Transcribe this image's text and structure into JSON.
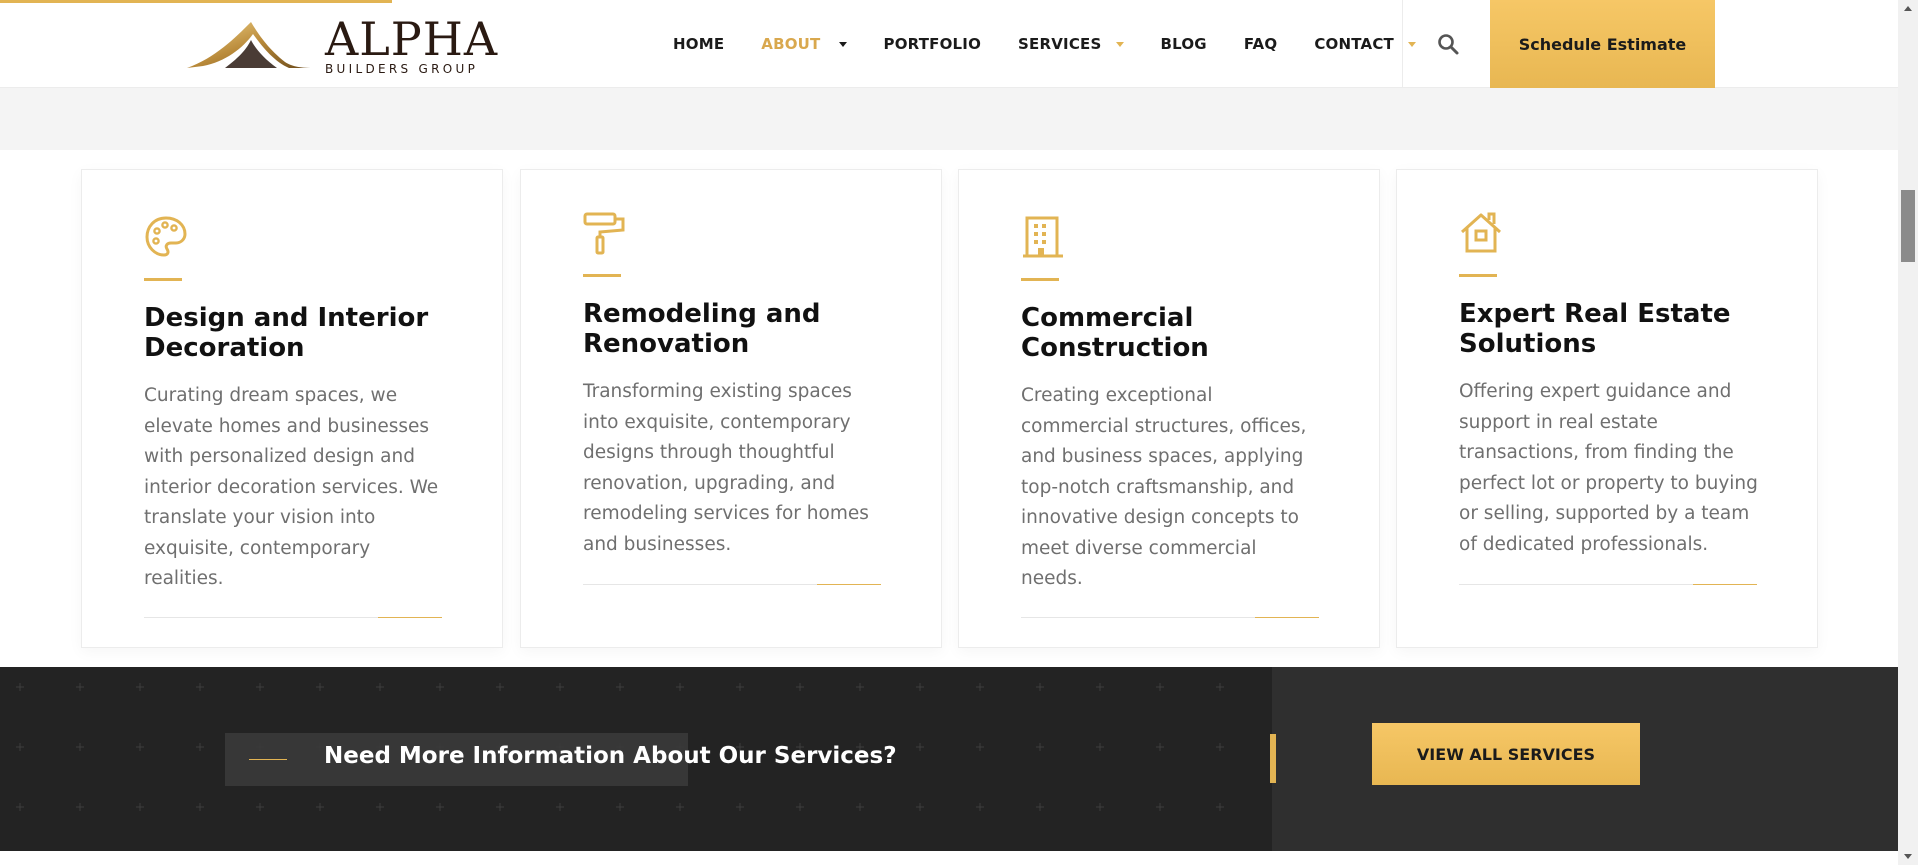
{
  "header": {
    "logo": {
      "main": "ALPHA",
      "sub": "BUILDERS GROUP"
    },
    "nav": [
      {
        "label": "HOME"
      },
      {
        "label": "ABOUT"
      },
      {
        "label": "PORTFOLIO"
      },
      {
        "label": "SERVICES"
      },
      {
        "label": "BLOG"
      },
      {
        "label": "FAQ"
      },
      {
        "label": "CONTACT"
      }
    ],
    "search_icon": "search-icon",
    "cta_label": "Schedule Estimate"
  },
  "cards": [
    {
      "icon": "palette-icon",
      "title": "Design and Interior Decoration",
      "description": "Curating dream spaces, we elevate homes and businesses with personalized design and interior decoration services. We translate your vision into exquisite, contemporary realities."
    },
    {
      "icon": "paint-roller-icon",
      "title": "Remodeling and Renovation",
      "description": "Transforming existing spaces into exquisite, contemporary designs through thoughtful renovation, upgrading, and remodeling services for homes and businesses."
    },
    {
      "icon": "building-icon",
      "title": "Commercial Construction",
      "description": "Creating exceptional commercial structures, offices, and business spaces, applying top-notch craftsmanship, and innovative design concepts to meet diverse commercial needs."
    },
    {
      "icon": "house-icon",
      "title": "Expert Real Estate Solutions",
      "description": "Offering expert guidance and support in real estate transactions, from finding the perfect lot or property to buying or selling, supported by a team of dedicated professionals."
    }
  ],
  "cta": {
    "text": "Need More Information About Our Services?",
    "button": "VIEW ALL SERVICES"
  },
  "colors": {
    "accent": "#e2b453",
    "dark": "#232323",
    "text_muted": "#6f6f6f"
  }
}
